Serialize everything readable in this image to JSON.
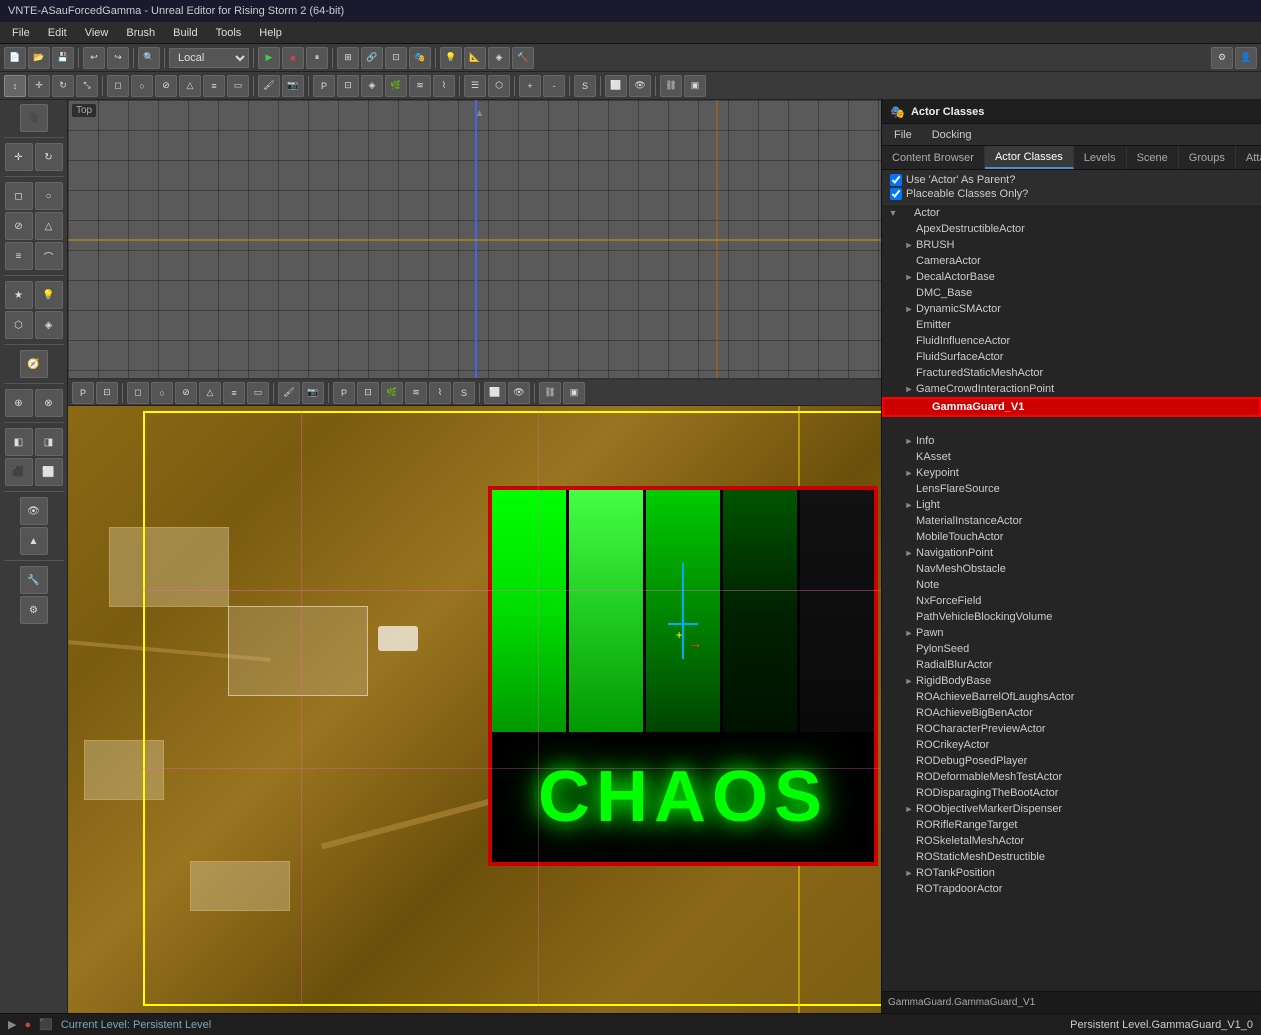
{
  "titlebar": {
    "text": "VNTE-ASauForcedGamma - Unreal Editor for Rising Storm 2 (64-bit)"
  },
  "menubar": {
    "items": [
      "File",
      "Edit",
      "View",
      "Brush",
      "Build",
      "Tools",
      "Help"
    ]
  },
  "toolbar1": {
    "mode_dropdown": "Local"
  },
  "panel": {
    "title": "Actor Classes",
    "icon": "🎭",
    "menu": [
      "File",
      "Docking"
    ],
    "tabs": [
      {
        "label": "Content Browser",
        "active": false
      },
      {
        "label": "Actor Classes",
        "active": true
      },
      {
        "label": "Levels",
        "active": false
      },
      {
        "label": "Scene",
        "active": false
      },
      {
        "label": "Groups",
        "active": false
      },
      {
        "label": "Attach...",
        "active": false
      }
    ],
    "checkboxes": [
      {
        "label": "Use 'Actor' As Parent?",
        "checked": true
      },
      {
        "label": "Placeable Classes Only?",
        "checked": true
      }
    ],
    "tree": {
      "root": "Actor",
      "items": [
        {
          "label": "Actor",
          "level": 0,
          "expand": "▼",
          "icon": ""
        },
        {
          "label": "ApexDestructibleActor",
          "level": 1,
          "expand": "",
          "icon": ""
        },
        {
          "label": "BRUSH",
          "level": 1,
          "expand": "►",
          "icon": ""
        },
        {
          "label": "CameraActor",
          "level": 1,
          "expand": "",
          "icon": ""
        },
        {
          "label": "DecalActorBase",
          "level": 1,
          "expand": "►",
          "icon": ""
        },
        {
          "label": "DMC_Base",
          "level": 1,
          "expand": "",
          "icon": ""
        },
        {
          "label": "DynamicSMActor",
          "level": 1,
          "expand": "►",
          "icon": ""
        },
        {
          "label": "Emitter",
          "level": 1,
          "expand": "",
          "icon": ""
        },
        {
          "label": "FluidInfluenceActor",
          "level": 1,
          "expand": "",
          "icon": ""
        },
        {
          "label": "FluidSurfaceActor",
          "level": 1,
          "expand": "",
          "icon": ""
        },
        {
          "label": "FracturedStaticMeshActor",
          "level": 1,
          "expand": "",
          "icon": ""
        },
        {
          "label": "GameCrowdInteractionPoint",
          "level": 1,
          "expand": "►",
          "icon": ""
        },
        {
          "label": "GammaGuard_V1",
          "level": 2,
          "expand": "",
          "icon": "",
          "selected": true,
          "highlighted": true
        },
        {
          "label": "Info",
          "level": 1,
          "expand": "►",
          "icon": ""
        },
        {
          "label": "KAsset",
          "level": 1,
          "expand": "",
          "icon": ""
        },
        {
          "label": "Keypoint",
          "level": 1,
          "expand": "►",
          "icon": ""
        },
        {
          "label": "LensFlareSource",
          "level": 1,
          "expand": "",
          "icon": ""
        },
        {
          "label": "Light",
          "level": 1,
          "expand": "►",
          "icon": ""
        },
        {
          "label": "MaterialInstanceActor",
          "level": 1,
          "expand": "",
          "icon": ""
        },
        {
          "label": "MobileTouchActor",
          "level": 1,
          "expand": "",
          "icon": ""
        },
        {
          "label": "NavigationPoint",
          "level": 1,
          "expand": "►",
          "icon": ""
        },
        {
          "label": "NavMeshObstacle",
          "level": 1,
          "expand": "",
          "icon": ""
        },
        {
          "label": "Note",
          "level": 1,
          "expand": "",
          "icon": ""
        },
        {
          "label": "NxForceField",
          "level": 1,
          "expand": "",
          "icon": ""
        },
        {
          "label": "PathVehicleBlockingVolume",
          "level": 1,
          "expand": "",
          "icon": ""
        },
        {
          "label": "Pawn",
          "level": 1,
          "expand": "►",
          "icon": ""
        },
        {
          "label": "PylonSeed",
          "level": 1,
          "expand": "",
          "icon": ""
        },
        {
          "label": "RadialBlurActor",
          "level": 1,
          "expand": "",
          "icon": ""
        },
        {
          "label": "RigidBodyBase",
          "level": 1,
          "expand": "►",
          "icon": ""
        },
        {
          "label": "ROAchieveBarrelOfLaughsActor",
          "level": 1,
          "expand": "",
          "icon": ""
        },
        {
          "label": "ROAchieveBigBenActor",
          "level": 1,
          "expand": "",
          "icon": ""
        },
        {
          "label": "ROCharacterPreviewActor",
          "level": 1,
          "expand": "",
          "icon": ""
        },
        {
          "label": "ROCrikeyActor",
          "level": 1,
          "expand": "",
          "icon": ""
        },
        {
          "label": "RODebugPosedPlayer",
          "level": 1,
          "expand": "",
          "icon": ""
        },
        {
          "label": "RODeformableMeshTestActor",
          "level": 1,
          "expand": "",
          "icon": ""
        },
        {
          "label": "RODisparagingTheBootActor",
          "level": 1,
          "expand": "",
          "icon": ""
        },
        {
          "label": "ROObjectiveMarkerDispenser",
          "level": 1,
          "expand": "►",
          "icon": ""
        },
        {
          "label": "RORifleRangeTarget",
          "level": 1,
          "expand": "",
          "icon": ""
        },
        {
          "label": "ROSkeletalMeshActor",
          "level": 1,
          "expand": "",
          "icon": ""
        },
        {
          "label": "ROStaticMeshDestructible",
          "level": 1,
          "expand": "",
          "icon": ""
        },
        {
          "label": "ROTankPosition",
          "level": 1,
          "expand": "►",
          "icon": ""
        },
        {
          "label": "ROTrapdoorActor",
          "level": 1,
          "expand": "",
          "icon": ""
        }
      ]
    },
    "statusbar": "GammaGuard.GammaGuard_V1"
  },
  "global_statusbar": {
    "icons": [
      "▶",
      "●",
      "⬛"
    ],
    "level_text": "Current Level:  Persistent Level",
    "right_text": "Persistent Level.GammaGuard_V1_0"
  },
  "chaos_text": "CHAOS"
}
